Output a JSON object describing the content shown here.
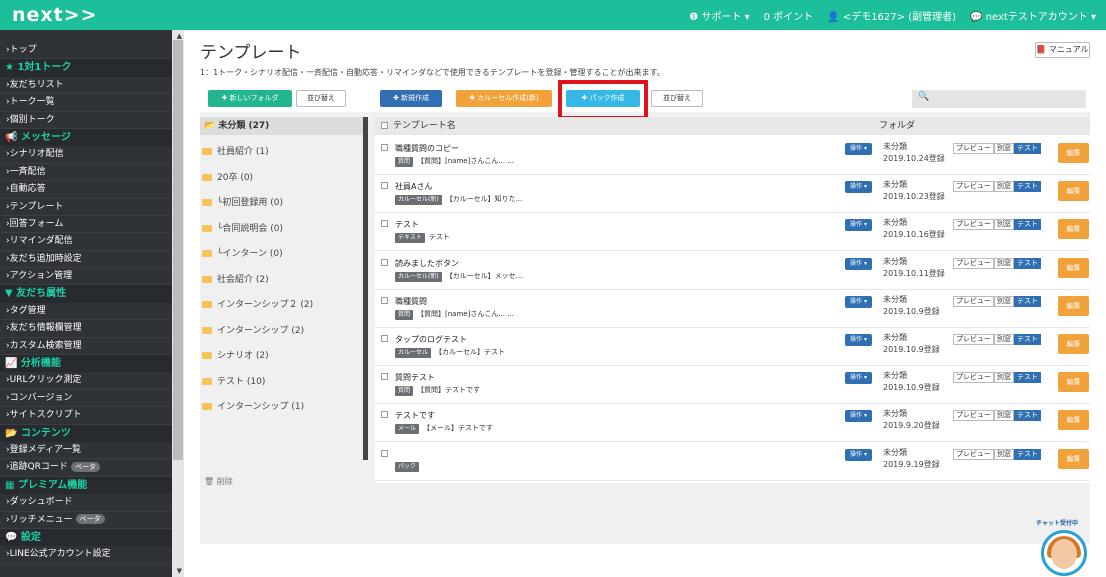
{
  "header": {
    "logo": "next",
    "support": "❶ サポート ▾",
    "points": "0 ポイント",
    "user": "👤 <デモ1627> (副管理者)",
    "account": "💬 nextテストアカウント ▾"
  },
  "sidebar": [
    {
      "t": "item",
      "label": "›トップ"
    },
    {
      "t": "sec",
      "label": "★ 1対1トーク"
    },
    {
      "t": "item",
      "label": "›友だちリスト"
    },
    {
      "t": "item",
      "label": "›トーク一覧"
    },
    {
      "t": "item",
      "label": "›個別トーク"
    },
    {
      "t": "sec",
      "label": "📢 メッセージ"
    },
    {
      "t": "item",
      "label": "›シナリオ配信"
    },
    {
      "t": "item",
      "label": "›一斉配信"
    },
    {
      "t": "item",
      "label": "›自動応答"
    },
    {
      "t": "item",
      "label": "›テンプレート"
    },
    {
      "t": "item",
      "label": "›回答フォーム"
    },
    {
      "t": "item",
      "label": "›リマインダ配信"
    },
    {
      "t": "item",
      "label": "›友だち追加時設定"
    },
    {
      "t": "item",
      "label": "›アクション管理"
    },
    {
      "t": "sec",
      "label": "▼ 友だち属性"
    },
    {
      "t": "item",
      "label": "›タグ管理"
    },
    {
      "t": "item",
      "label": "›友だち情報欄管理"
    },
    {
      "t": "item",
      "label": "›カスタム検索管理"
    },
    {
      "t": "sec",
      "label": "📈 分析機能"
    },
    {
      "t": "item",
      "label": "›URLクリック測定"
    },
    {
      "t": "item",
      "label": "›コンバージョン"
    },
    {
      "t": "item",
      "label": "›サイトスクリプト"
    },
    {
      "t": "sec",
      "label": "📂 コンテンツ"
    },
    {
      "t": "item",
      "label": "›登録メディア一覧"
    },
    {
      "t": "item",
      "label": "›追跡QRコード",
      "badge": "ベータ"
    },
    {
      "t": "sec",
      "label": "▦ プレミアム機能"
    },
    {
      "t": "item",
      "label": "›ダッシュボード"
    },
    {
      "t": "item",
      "label": "›リッチメニュー",
      "badge": "ベータ"
    },
    {
      "t": "sec",
      "label": "💬 設定"
    },
    {
      "t": "item",
      "label": "›LINE公式アカウント設定"
    }
  ],
  "page": {
    "title": "テンプレート",
    "description": "1：1トーク・シナリオ配信・一斉配信・自動応答・リマインダなどで使用できるテンプレートを登録・管理することが出来ます。",
    "manual": "📕 マニュアル"
  },
  "toolbar": {
    "new_folder": "✚ 新しいフォルダ",
    "sort_folder": "並び替え",
    "new_create": "✚ 新規作成",
    "carousel": "✚ カルーセル作成(新)",
    "pack": "✚ パック作成",
    "sort": "並び替え",
    "search_icon": "🔍"
  },
  "folders": {
    "head": "📂 未分類 (27)",
    "items": [
      "社員紹介 (1)",
      "20卒 (0)",
      "└初回登録用 (0)",
      "└合同説明会 (0)",
      "└インターン (0)",
      "社会紹介 (2)",
      "インターンシップ２ (2)",
      "インターンシップ (2)",
      "シナリオ (2)",
      "テスト (10)",
      "インターンシップ (1)"
    ],
    "delete": "🗑 削除"
  },
  "table": {
    "col_name": "テンプレート名",
    "col_folder": "フォルダ",
    "op_label": "操作 ▾",
    "preview": "プレビュー",
    "separate": "別窓",
    "test": "テスト",
    "edit": "編集",
    "rows": [
      {
        "name": "職種質問のコピー",
        "tag": "質問",
        "text": "【質問】[name]さんこん... ...",
        "folder": "未分類",
        "date": "2019.10.24登録"
      },
      {
        "name": "社員Aさん",
        "tag": "カルーセル(新)",
        "text": "【カルーセル】知りた...",
        "folder": "未分類",
        "date": "2019.10.23登録"
      },
      {
        "name": "テスト",
        "tag": "テキスト",
        "text": "テスト",
        "folder": "未分類",
        "date": "2019.10.16登録"
      },
      {
        "name": "読みましたボタン",
        "tag": "カルーセル(新)",
        "text": "【カルーセル】メッセ...",
        "folder": "未分類",
        "date": "2019.10.11登録"
      },
      {
        "name": "職種質問",
        "tag": "質問",
        "text": "【質問】[name]さんこん... ...",
        "folder": "未分類",
        "date": "2019.10.9登録"
      },
      {
        "name": "タップのログテスト",
        "tag": "カルーセル",
        "text": "【カルーセル】テスト",
        "folder": "未分類",
        "date": "2019.10.9登録"
      },
      {
        "name": "質問テスト",
        "tag": "質問",
        "text": "【質問】テストです",
        "folder": "未分類",
        "date": "2019.10.9登録"
      },
      {
        "name": "テストです",
        "tag": "メール",
        "text": "【メール】テストです",
        "folder": "未分類",
        "date": "2019.9.20登録"
      },
      {
        "name": "",
        "tag": "パック",
        "text": "",
        "folder": "未分類",
        "date": "2019.9.19登録"
      }
    ]
  },
  "chat": {
    "label": "チャット受付中"
  }
}
